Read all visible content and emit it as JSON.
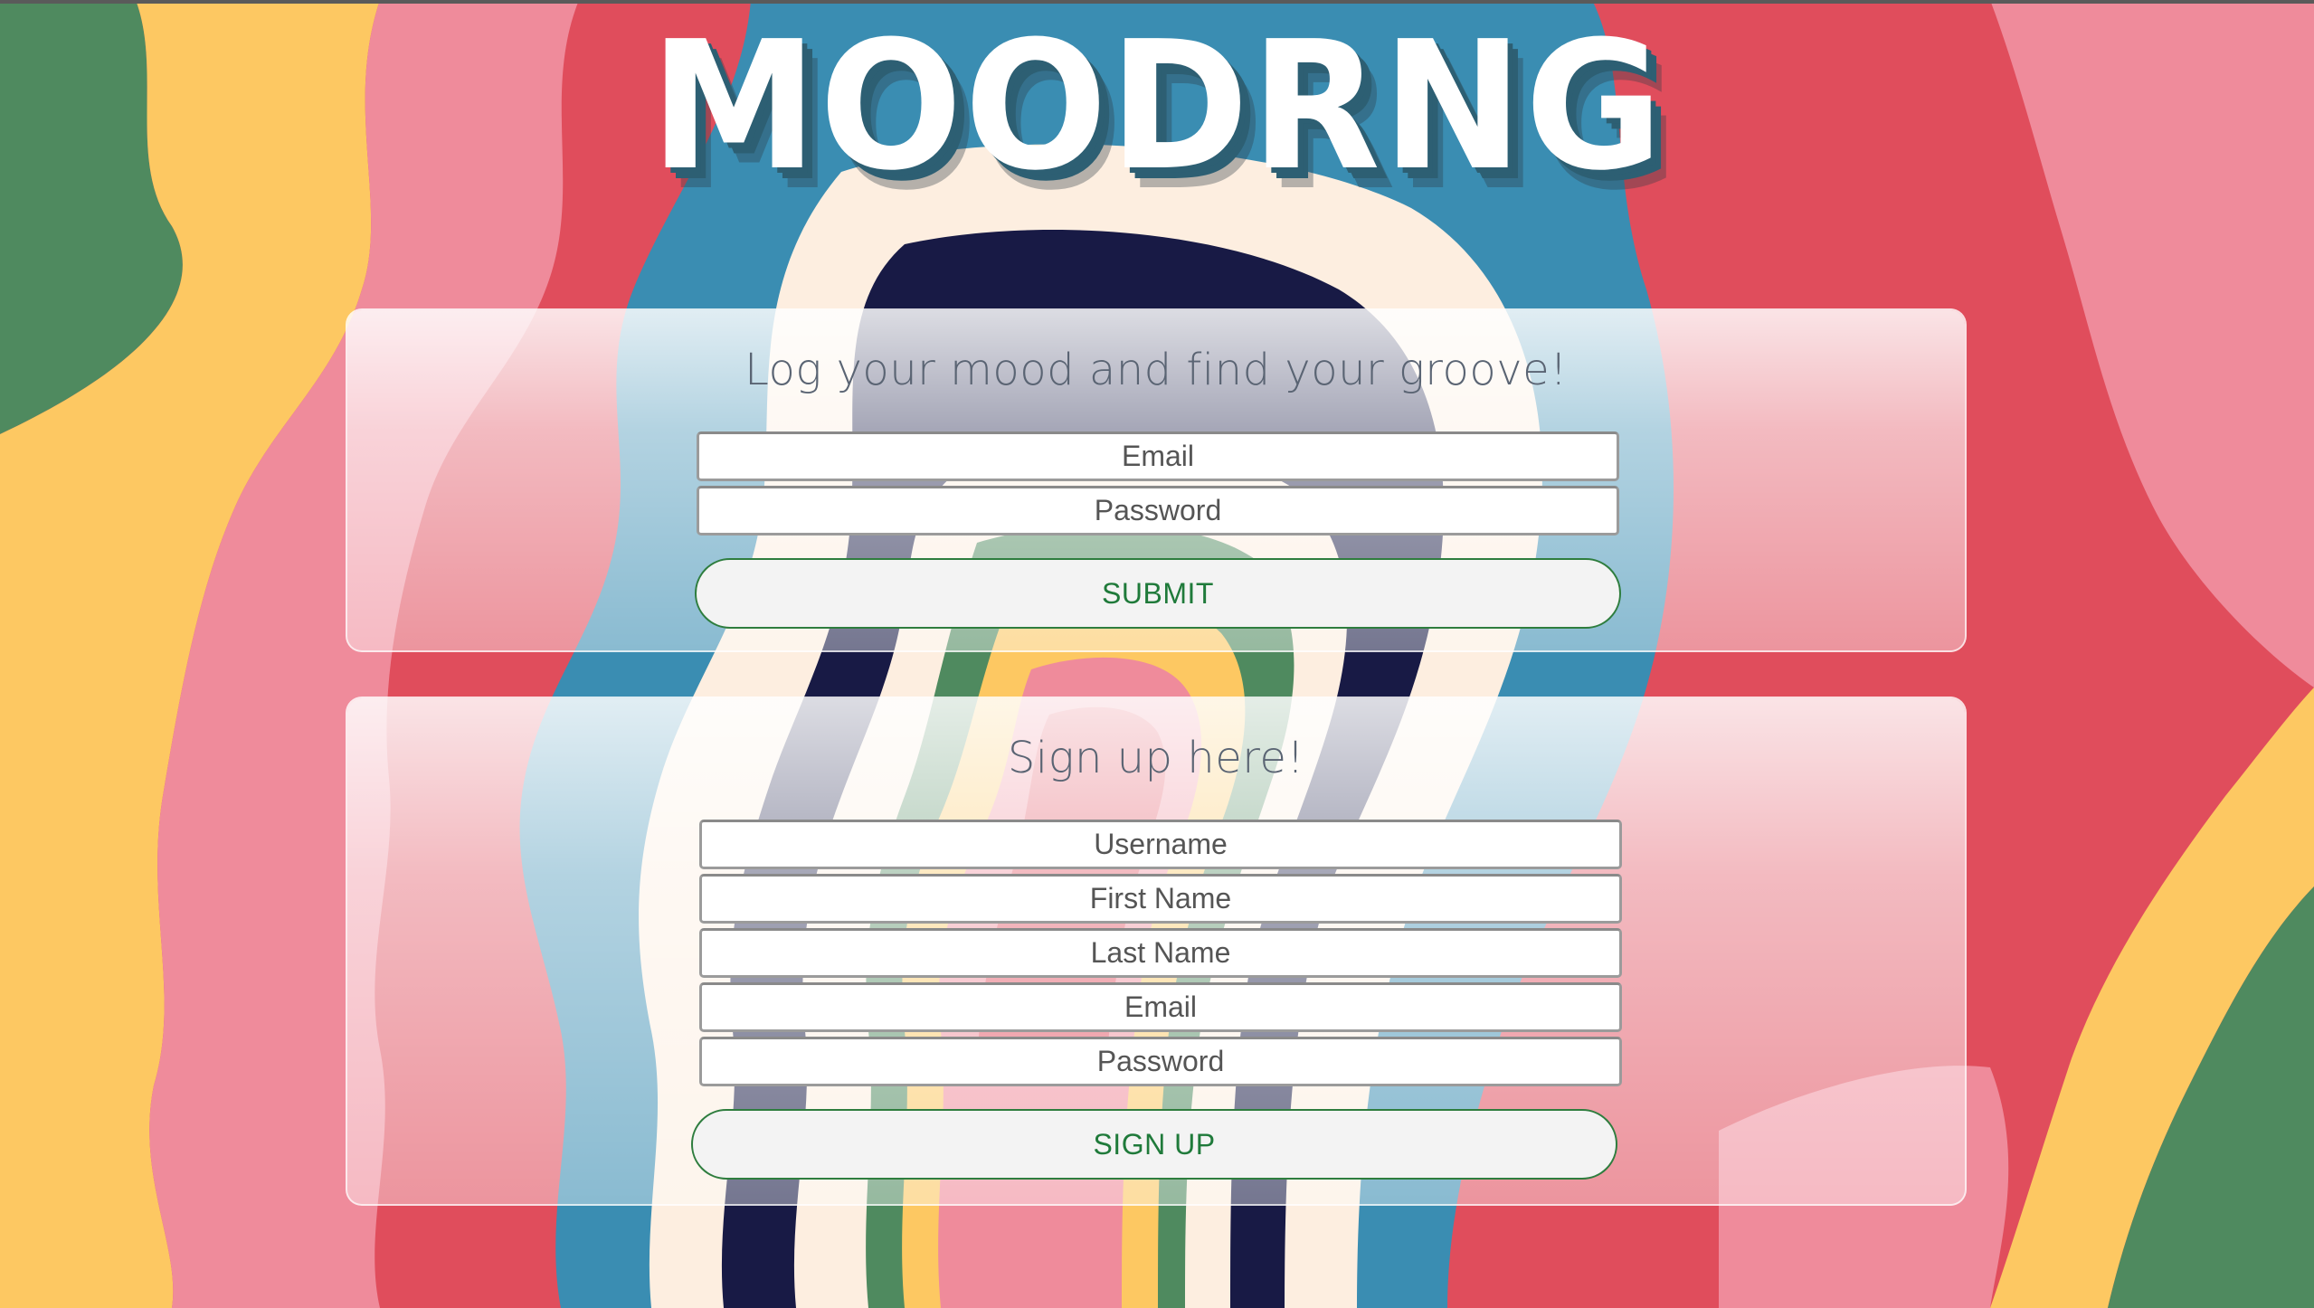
{
  "app": {
    "logo_text": "MOODRNG"
  },
  "login": {
    "title": "Log your mood and find your groove!",
    "email_placeholder": "Email",
    "password_placeholder": "Password",
    "submit_label": "SUBMIT"
  },
  "signup": {
    "title": "Sign up here!",
    "username_placeholder": "Username",
    "first_name_placeholder": "First Name",
    "last_name_placeholder": "Last Name",
    "email_placeholder": "Email",
    "password_placeholder": "Password",
    "submit_label": "SIGN UP"
  },
  "colors": {
    "button_text": "#1f7a3a",
    "button_border": "#2e7d3e",
    "title_text": "#5a6473",
    "bg_red": "#e04d5c",
    "bg_pink": "#ef8b9b",
    "bg_yellow": "#fdc862",
    "bg_green": "#4f8a5f",
    "bg_blue": "#3a8db2",
    "bg_cream": "#fdeee0",
    "bg_navy": "#181a45"
  }
}
